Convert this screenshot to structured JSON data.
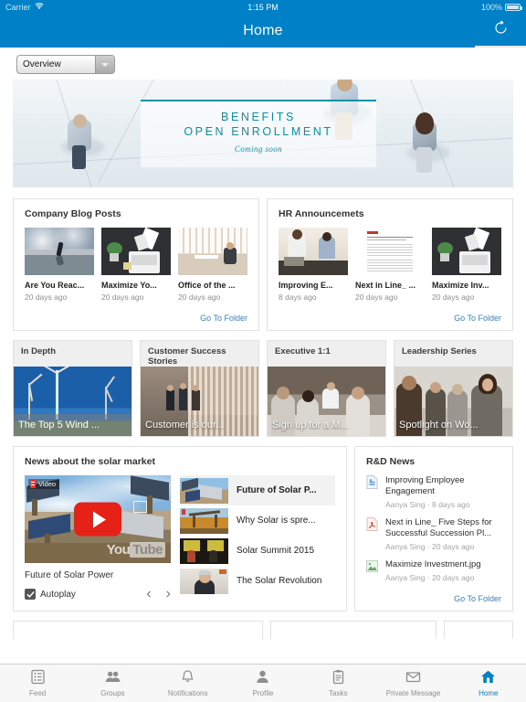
{
  "status": {
    "carrier": "Carrier",
    "wifi_icon": "wifi-icon",
    "time": "1:15 PM",
    "battery": "100%"
  },
  "nav": {
    "title": "Home",
    "refresh_icon": "refresh-icon"
  },
  "toolbar": {
    "select_value": "Overview",
    "select_options": [
      "Overview"
    ]
  },
  "hero": {
    "line1": "BENEFITS",
    "line2": "OPEN ENROLLMENT",
    "line3": "Coming soon"
  },
  "blog": {
    "title": "Company Blog Posts",
    "go_to_folder": "Go To Folder",
    "items": [
      {
        "title": "Are You Reac...",
        "meta": "20 days ago"
      },
      {
        "title": "Maximize Yo...",
        "meta": "20 days ago"
      },
      {
        "title": "Office of the ...",
        "meta": "20 days ago"
      }
    ]
  },
  "hr": {
    "title": "HR Announcemets",
    "go_to_folder": "Go To Folder",
    "items": [
      {
        "title": "Improving E...",
        "meta": "8 days ago"
      },
      {
        "title": "Next in Line_ ...",
        "meta": "20 days ago"
      },
      {
        "title": "Maximize Inv...",
        "meta": "20 days ago"
      }
    ]
  },
  "tiles": [
    {
      "header": "In Depth",
      "caption": "The Top 5 Wind ..."
    },
    {
      "header": "Customer Success Stories",
      "caption": "Customer is our..."
    },
    {
      "header": "Executive 1:1",
      "caption": "Sign up for a M..."
    },
    {
      "header": "Leadership Series",
      "caption": "Spotlight on Wo..."
    }
  ],
  "video": {
    "title": "News about the solar market",
    "badge": "Video",
    "brand": "YouTube",
    "play_icon": "play-icon",
    "fullscreen_icon": "fullscreen-icon",
    "current_name": "Future of Solar Power",
    "autoplay_label": "Autoplay",
    "autoplay_checked": true,
    "prev_icon": "chevron-left-icon",
    "next_icon": "chevron-right-icon",
    "playlist": [
      {
        "title": "Future of Solar P..."
      },
      {
        "title": "Why Solar is spre..."
      },
      {
        "title": "Solar Summit 2015"
      },
      {
        "title": "The Solar Revolution"
      }
    ]
  },
  "rd": {
    "title": "R&D News",
    "go_to_folder": "Go To Folder",
    "items": [
      {
        "name": "Improving Employee Engagement",
        "meta": "Aanya Sing · 8 days ago",
        "icon": "doc-file-icon"
      },
      {
        "name": "Next in Line_ Five Steps for Successful Succession Pl...",
        "meta": "Aanya Sing · 20 days ago",
        "icon": "pdf-file-icon"
      },
      {
        "name": "Maximize Investment.jpg",
        "meta": "Aanya Sing · 20 days ago",
        "icon": "image-file-icon"
      }
    ]
  },
  "tabs": [
    {
      "label": "Feed",
      "icon": "feed-icon",
      "active": false
    },
    {
      "label": "Groups",
      "icon": "groups-icon",
      "active": false
    },
    {
      "label": "Notifications",
      "icon": "bell-icon",
      "active": false
    },
    {
      "label": "Profile",
      "icon": "person-icon",
      "active": false
    },
    {
      "label": "Tasks",
      "icon": "clipboard-icon",
      "active": false
    },
    {
      "label": "Private Message",
      "icon": "envelope-icon",
      "active": false
    },
    {
      "label": "Home",
      "icon": "home-icon",
      "active": true
    }
  ],
  "colors": {
    "brand_blue": "#0080c6",
    "link_blue": "#3c7fbd",
    "teal": "#1292a8",
    "yt_red": "#e62117"
  }
}
